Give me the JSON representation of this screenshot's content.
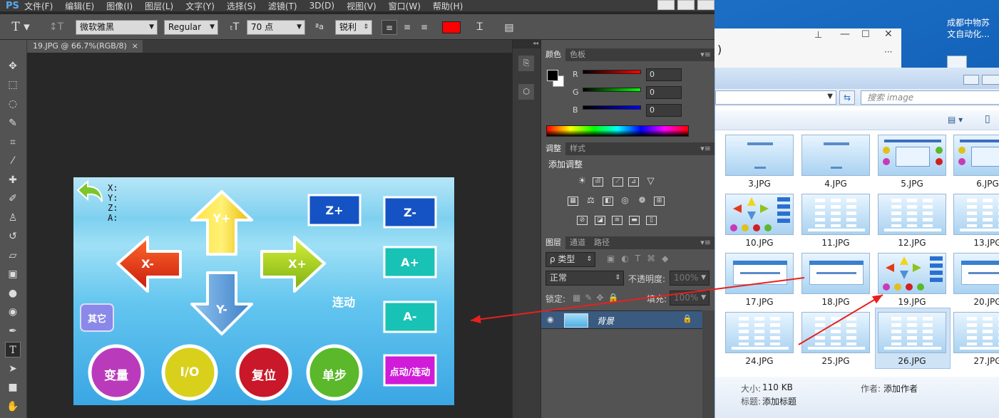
{
  "ps": {
    "logo": "PS",
    "menus": [
      "文件(F)",
      "编辑(E)",
      "图像(I)",
      "图层(L)",
      "文字(Y)",
      "选择(S)",
      "滤镜(T)",
      "3D(D)",
      "视图(V)",
      "窗口(W)",
      "帮助(H)"
    ],
    "options": {
      "tool_glyph": "T",
      "font_family": "微软雅黑",
      "font_style": "Regular",
      "font_size": "70 点",
      "aa_label": "ªa",
      "antialias": "锐利",
      "text_color": "#ff0000"
    },
    "doc_tab": {
      "title": "19.JPG @ 66.7%(RGB/8)",
      "close": "×"
    },
    "canvas": {
      "coords": [
        "X:",
        "Y:",
        "Z:",
        "A:"
      ],
      "buttons": {
        "y_plus": "Y+",
        "y_minus": "Y-",
        "x_plus": "X+",
        "x_minus": "X-",
        "z_plus": "Z+",
        "z_minus": "Z-",
        "a_plus": "A+",
        "a_minus": "A-",
        "continuous": "连动",
        "other": "其它",
        "var": "变量",
        "io": "I/O",
        "reset": "复位",
        "step": "单步",
        "mode": "点动/连动"
      }
    },
    "color_panel": {
      "tabs": [
        "颜色",
        "色板"
      ],
      "channels": [
        {
          "name": "R",
          "value": "0"
        },
        {
          "name": "G",
          "value": "0"
        },
        {
          "name": "B",
          "value": "0"
        }
      ]
    },
    "adjust_panel": {
      "tabs": [
        "调整",
        "样式"
      ],
      "title": "添加调整"
    },
    "layers_panel": {
      "tabs": [
        "图层",
        "通道",
        "路径"
      ],
      "kind_label": "ρ 类型",
      "blend_mode": "正常",
      "opacity_label": "不透明度:",
      "opacity": "100%",
      "lock_label": "锁定:",
      "fill_label": "填充:",
      "fill": "100%",
      "layer_name": "背景"
    }
  },
  "explorer": {
    "desktop_icon_label": [
      "成都中物苏",
      "文自动化..."
    ],
    "back_window_label": ")",
    "search_placeholder": "搜索 image",
    "thumbs": [
      {
        "name": "3.JPG",
        "style": "title"
      },
      {
        "name": "4.JPG",
        "style": "title"
      },
      {
        "name": "5.JPG",
        "style": "color"
      },
      {
        "name": "6.JPG",
        "style": "color"
      },
      {
        "name": "10.JPG",
        "style": "arrows"
      },
      {
        "name": "11.JPG",
        "style": "list"
      },
      {
        "name": "12.JPG",
        "style": "list"
      },
      {
        "name": "13.JPG",
        "style": "list"
      },
      {
        "name": "17.JPG",
        "style": "dialog"
      },
      {
        "name": "18.JPG",
        "style": "dialog"
      },
      {
        "name": "19.JPG",
        "style": "arrows"
      },
      {
        "name": "20.JPG",
        "style": "dialog"
      },
      {
        "name": "24.JPG",
        "style": "list"
      },
      {
        "name": "25.JPG",
        "style": "list"
      },
      {
        "name": "26.JPG",
        "style": "list"
      },
      {
        "name": "27.JPG",
        "style": "list"
      }
    ],
    "details": {
      "size_label": "大小:",
      "size": "110 KB",
      "tag_label": "标题:",
      "tag": "添加标题",
      "author_label": "作者:",
      "author": "添加作者"
    }
  },
  "colors": {
    "annotation_arrow": "#e8201e",
    "selected_thumb": "#cfe3f7"
  }
}
